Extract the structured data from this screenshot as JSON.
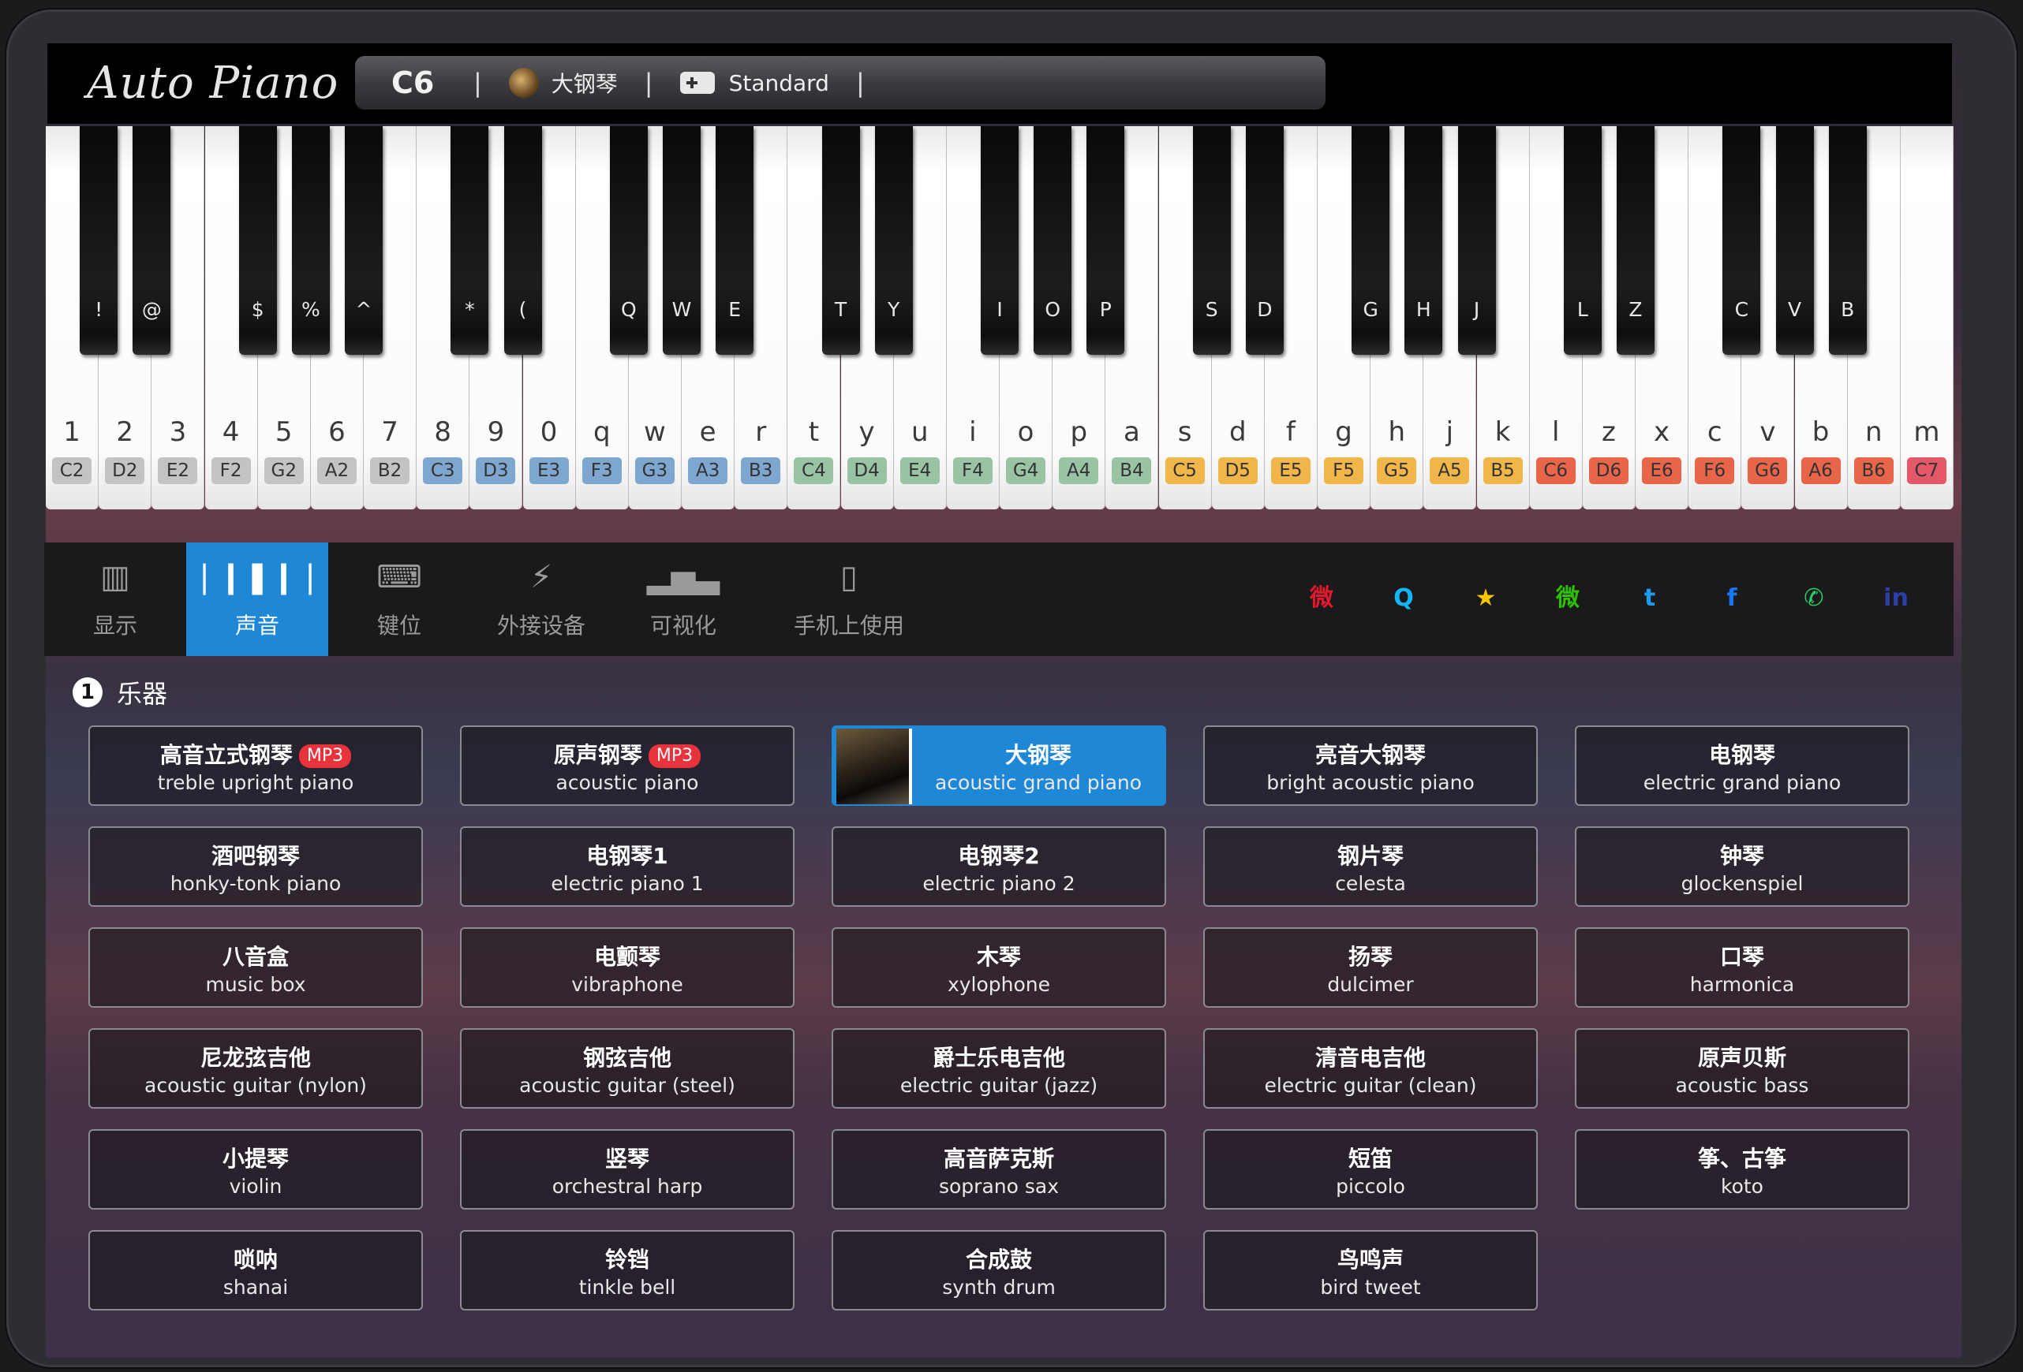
{
  "header": {
    "logo_text": "Auto Piano",
    "current_note": "C6",
    "separator": "|",
    "instrument_name": "大钢琴",
    "mode": "Standard"
  },
  "keyboard": {
    "white_keys": [
      {
        "char": "1",
        "note": "C2",
        "color": "gray"
      },
      {
        "char": "2",
        "note": "D2",
        "color": "gray"
      },
      {
        "char": "3",
        "note": "E2",
        "color": "gray"
      },
      {
        "char": "4",
        "note": "F2",
        "color": "gray"
      },
      {
        "char": "5",
        "note": "G2",
        "color": "gray"
      },
      {
        "char": "6",
        "note": "A2",
        "color": "gray"
      },
      {
        "char": "7",
        "note": "B2",
        "color": "gray"
      },
      {
        "char": "8",
        "note": "C3",
        "color": "blue"
      },
      {
        "char": "9",
        "note": "D3",
        "color": "blue"
      },
      {
        "char": "0",
        "note": "E3",
        "color": "blue"
      },
      {
        "char": "q",
        "note": "F3",
        "color": "blue"
      },
      {
        "char": "w",
        "note": "G3",
        "color": "blue"
      },
      {
        "char": "e",
        "note": "A3",
        "color": "blue"
      },
      {
        "char": "r",
        "note": "B3",
        "color": "blue"
      },
      {
        "char": "t",
        "note": "C4",
        "color": "green"
      },
      {
        "char": "y",
        "note": "D4",
        "color": "green"
      },
      {
        "char": "u",
        "note": "E4",
        "color": "green"
      },
      {
        "char": "i",
        "note": "F4",
        "color": "green"
      },
      {
        "char": "o",
        "note": "G4",
        "color": "green"
      },
      {
        "char": "p",
        "note": "A4",
        "color": "green"
      },
      {
        "char": "a",
        "note": "B4",
        "color": "green"
      },
      {
        "char": "s",
        "note": "C5",
        "color": "yellow"
      },
      {
        "char": "d",
        "note": "D5",
        "color": "yellow"
      },
      {
        "char": "f",
        "note": "E5",
        "color": "yellow"
      },
      {
        "char": "g",
        "note": "F5",
        "color": "yellow"
      },
      {
        "char": "h",
        "note": "G5",
        "color": "yellow"
      },
      {
        "char": "j",
        "note": "A5",
        "color": "yellow"
      },
      {
        "char": "k",
        "note": "B5",
        "color": "yellow"
      },
      {
        "char": "l",
        "note": "C6",
        "color": "red"
      },
      {
        "char": "z",
        "note": "D6",
        "color": "red"
      },
      {
        "char": "x",
        "note": "E6",
        "color": "red"
      },
      {
        "char": "c",
        "note": "F6",
        "color": "red"
      },
      {
        "char": "v",
        "note": "G6",
        "color": "red"
      },
      {
        "char": "b",
        "note": "A6",
        "color": "red"
      },
      {
        "char": "n",
        "note": "B6",
        "color": "red"
      },
      {
        "char": "m",
        "note": "C7",
        "color": "pink"
      }
    ],
    "black_keys": [
      "!",
      "@",
      "$",
      "%",
      "^",
      "*",
      "(",
      "Q",
      "W",
      "E",
      "T",
      "Y",
      "I",
      "O",
      "P",
      "S",
      "D",
      "G",
      "H",
      "J",
      "L",
      "Z",
      "C",
      "V",
      "B"
    ]
  },
  "tabs": [
    {
      "label": "显示",
      "icon": "piano-icon",
      "active": false
    },
    {
      "label": "声音",
      "icon": "waveform-icon",
      "active": true
    },
    {
      "label": "键位",
      "icon": "keyboard-icon",
      "active": false
    },
    {
      "label": "外接设备",
      "icon": "plug-icon",
      "active": false
    },
    {
      "label": "可视化",
      "icon": "bar-chart-icon",
      "active": false
    },
    {
      "label": "手机上使用",
      "icon": "phone-icon",
      "active": false
    }
  ],
  "social": [
    {
      "name": "weibo-icon",
      "color": "#e6162d",
      "glyph": "微"
    },
    {
      "name": "qq-icon",
      "color": "#12b7f5",
      "glyph": "Q"
    },
    {
      "name": "qzone-icon",
      "color": "#f7c600",
      "glyph": "★"
    },
    {
      "name": "wechat-icon",
      "color": "#2dc100",
      "glyph": "微"
    },
    {
      "name": "twitter-icon",
      "color": "#1d9bf0",
      "glyph": "t"
    },
    {
      "name": "facebook-icon",
      "color": "#1877f2",
      "glyph": "f"
    },
    {
      "name": "whatsapp-icon",
      "color": "#25d366",
      "glyph": "✆"
    },
    {
      "name": "linkedin-icon",
      "color": "#2f3fa8",
      "glyph": "in"
    }
  ],
  "section": {
    "number": "1",
    "title": "乐器"
  },
  "instruments": [
    {
      "zh": "高音立式钢琴",
      "en": "treble upright piano",
      "badge": "MP3"
    },
    {
      "zh": "原声钢琴",
      "en": "acoustic piano",
      "badge": "MP3"
    },
    {
      "zh": "大钢琴",
      "en": "acoustic grand piano",
      "active": true
    },
    {
      "zh": "亮音大钢琴",
      "en": "bright acoustic piano"
    },
    {
      "zh": "电钢琴",
      "en": "electric grand piano"
    },
    {
      "zh": "酒吧钢琴",
      "en": "honky-tonk piano"
    },
    {
      "zh": "电钢琴1",
      "en": "electric piano 1"
    },
    {
      "zh": "电钢琴2",
      "en": "electric piano 2"
    },
    {
      "zh": "钢片琴",
      "en": "celesta"
    },
    {
      "zh": "钟琴",
      "en": "glockenspiel"
    },
    {
      "zh": "八音盒",
      "en": "music box"
    },
    {
      "zh": "电颤琴",
      "en": "vibraphone"
    },
    {
      "zh": "木琴",
      "en": "xylophone"
    },
    {
      "zh": "扬琴",
      "en": "dulcimer"
    },
    {
      "zh": "口琴",
      "en": "harmonica"
    },
    {
      "zh": "尼龙弦吉他",
      "en": "acoustic guitar (nylon)"
    },
    {
      "zh": "钢弦吉他",
      "en": "acoustic guitar (steel)"
    },
    {
      "zh": "爵士乐电吉他",
      "en": "electric guitar (jazz)"
    },
    {
      "zh": "清音电吉他",
      "en": "electric guitar (clean)"
    },
    {
      "zh": "原声贝斯",
      "en": "acoustic bass"
    },
    {
      "zh": "小提琴",
      "en": "violin"
    },
    {
      "zh": "竖琴",
      "en": "orchestral harp"
    },
    {
      "zh": "高音萨克斯",
      "en": "soprano sax"
    },
    {
      "zh": "短笛",
      "en": "piccolo"
    },
    {
      "zh": "筝、古筝",
      "en": "koto"
    },
    {
      "zh": "唢呐",
      "en": "shanai"
    },
    {
      "zh": "铃铛",
      "en": "tinkle bell"
    },
    {
      "zh": "合成鼓",
      "en": "synth drum"
    },
    {
      "zh": "鸟鸣声",
      "en": "bird tweet"
    }
  ]
}
